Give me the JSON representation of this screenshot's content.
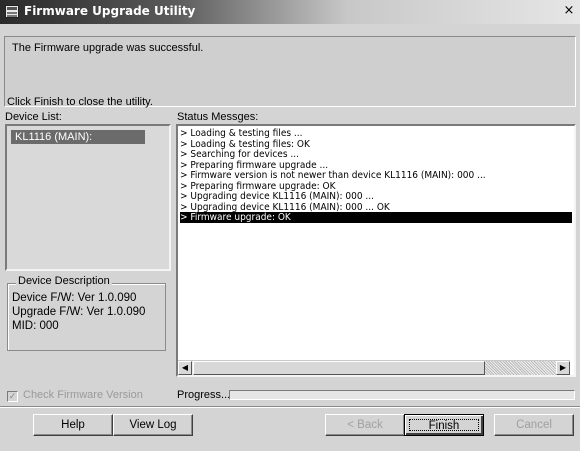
{
  "window": {
    "title": "Firmware Upgrade Utility",
    "close_glyph": "×"
  },
  "message": {
    "line1": "The Firmware upgrade was successful.",
    "line2": "Click Finish to close the utility."
  },
  "device_list": {
    "label": "Device List:",
    "items": [
      "KL1116 (MAIN):"
    ]
  },
  "device_description": {
    "title": "Device Description",
    "device_fw": "Device F/W: Ver 1.0.090",
    "upgrade_fw": "Upgrade F/W: Ver 1.0.090",
    "mid": "MID: 000"
  },
  "status": {
    "label": "Status Messges:",
    "lines": [
      "> Loading & testing files ...",
      "> Loading & testing files: OK",
      "> Searching for devices ...",
      "> Preparing firmware upgrade ...",
      "> Firmware version is not newer than device KL1116 (MAIN): 000 ...",
      "> Preparing firmware upgrade: OK",
      "> Upgrading device KL1116 (MAIN): 000 ...",
      "> Upgrading device KL1116 (MAIN): 000 ... OK",
      "> Firmware upgrade: OK"
    ],
    "selected_index": 8
  },
  "check_firmware": {
    "label": "Check Firmware Version",
    "checked": true,
    "enabled": false
  },
  "progress": {
    "label": "Progress...",
    "value": 0
  },
  "buttons": {
    "help": "Help",
    "view_log": "View Log",
    "back": "< Back",
    "finish": "Finish",
    "cancel": "Cancel"
  },
  "icons": {
    "app": "app-window-icon",
    "scroll_left": "◀",
    "scroll_right": "▶",
    "check": "✓"
  }
}
